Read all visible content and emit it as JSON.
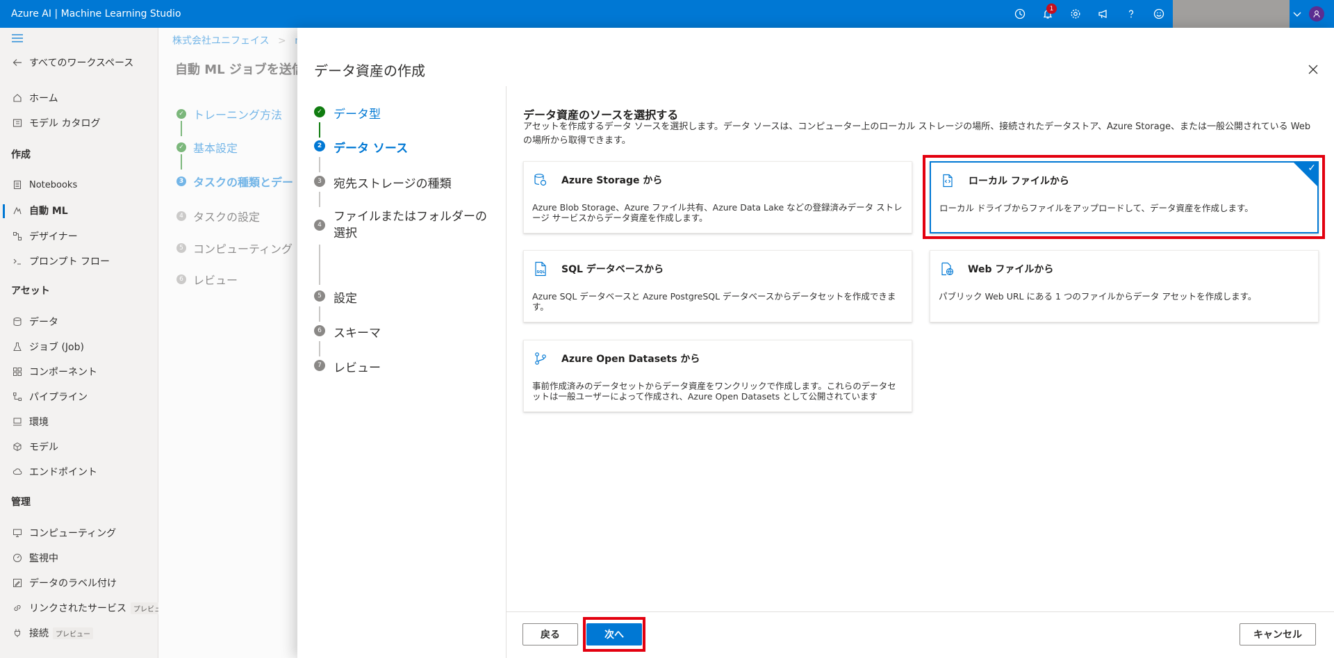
{
  "app": {
    "title": "Azure AI | Machine Learning Studio"
  },
  "topbar": {
    "notification_count": "1"
  },
  "nav": {
    "back_label": "すべてのワークスペース",
    "items": [
      {
        "label": "ホーム",
        "icon": "home-icon"
      },
      {
        "label": "モデル カタログ",
        "icon": "catalog-icon"
      }
    ],
    "section_create": "作成",
    "create_items": [
      {
        "label": "Notebooks"
      },
      {
        "label": "自動 ML"
      },
      {
        "label": "デザイナー"
      },
      {
        "label": "プロンプト フロー"
      }
    ],
    "section_assets": "アセット",
    "asset_items": [
      {
        "label": "データ"
      },
      {
        "label": "ジョブ (Job)"
      },
      {
        "label": "コンポーネント"
      },
      {
        "label": "パイプライン"
      },
      {
        "label": "環境"
      },
      {
        "label": "モデル"
      },
      {
        "label": "エンドポイント"
      }
    ],
    "section_manage": "管理",
    "manage_items": [
      {
        "label": "コンピューティング"
      },
      {
        "label": "監視中"
      },
      {
        "label": "データのラベル付け"
      },
      {
        "label": "リンクされたサービス",
        "tag": "プレビュー"
      },
      {
        "label": "接続",
        "tag": "プレビュー"
      }
    ]
  },
  "bg": {
    "breadcrumb": "株式会社ユニフェイス",
    "breadcrumb_sep": ">",
    "breadcrumb_next": "m",
    "title": "自動 ML ジョブを送信",
    "steps": [
      {
        "label": "トレーニング方法"
      },
      {
        "label": "基本設定"
      },
      {
        "label": "タスクの種類とデー",
        "num": "3"
      },
      {
        "label": "タスクの設定",
        "num": "4"
      },
      {
        "label": "コンピューティング",
        "num": "5"
      },
      {
        "label": "レビュー",
        "num": "6"
      }
    ]
  },
  "panel": {
    "title": "データ資産の作成",
    "steps": [
      {
        "label": "データ型",
        "num": ""
      },
      {
        "label": "データ ソース",
        "num": "2"
      },
      {
        "label": "宛先ストレージの種類",
        "num": "3"
      },
      {
        "label": "ファイルまたはフォルダーの選択",
        "num": "4"
      },
      {
        "label": "設定",
        "num": "5"
      },
      {
        "label": "スキーマ",
        "num": "6"
      },
      {
        "label": "レビュー",
        "num": "7"
      }
    ],
    "heading": "データ資産のソースを選択する",
    "description": "アセットを作成するデータ ソースを選択します。データ ソースは、コンピューター上のローカル ストレージの場所、接続されたデータストア、Azure Storage、または一般公開されている Web の場所から取得できます。",
    "cards": [
      {
        "title": "Azure Storage から",
        "desc": "Azure Blob Storage、Azure ファイル共有、Azure Data Lake などの登録済みデータ ストレージ サービスからデータ資産を作成します。"
      },
      {
        "title": "ローカル ファイルから",
        "desc": "ローカル ドライブからファイルをアップロードして、データ資産を作成します。"
      },
      {
        "title": "SQL データベースから",
        "desc": "Azure SQL データベースと Azure PostgreSQL データベースからデータセットを作成できます。"
      },
      {
        "title": "Web ファイルから",
        "desc": "パブリック Web URL にある 1 つのファイルからデータ アセットを作成します。"
      },
      {
        "title": "Azure Open Datasets から",
        "desc": "事前作成済みのデータセットからデータ資産をワンクリックで作成します。これらのデータセットは一般ユーザーによって作成され、Azure Open Datasets として公開されています"
      }
    ],
    "buttons": {
      "back": "戻る",
      "next": "次へ",
      "cancel": "キャンセル"
    }
  },
  "colors": {
    "accent": "#0078d4",
    "success": "#107c10",
    "highlight": "#e3000f"
  }
}
